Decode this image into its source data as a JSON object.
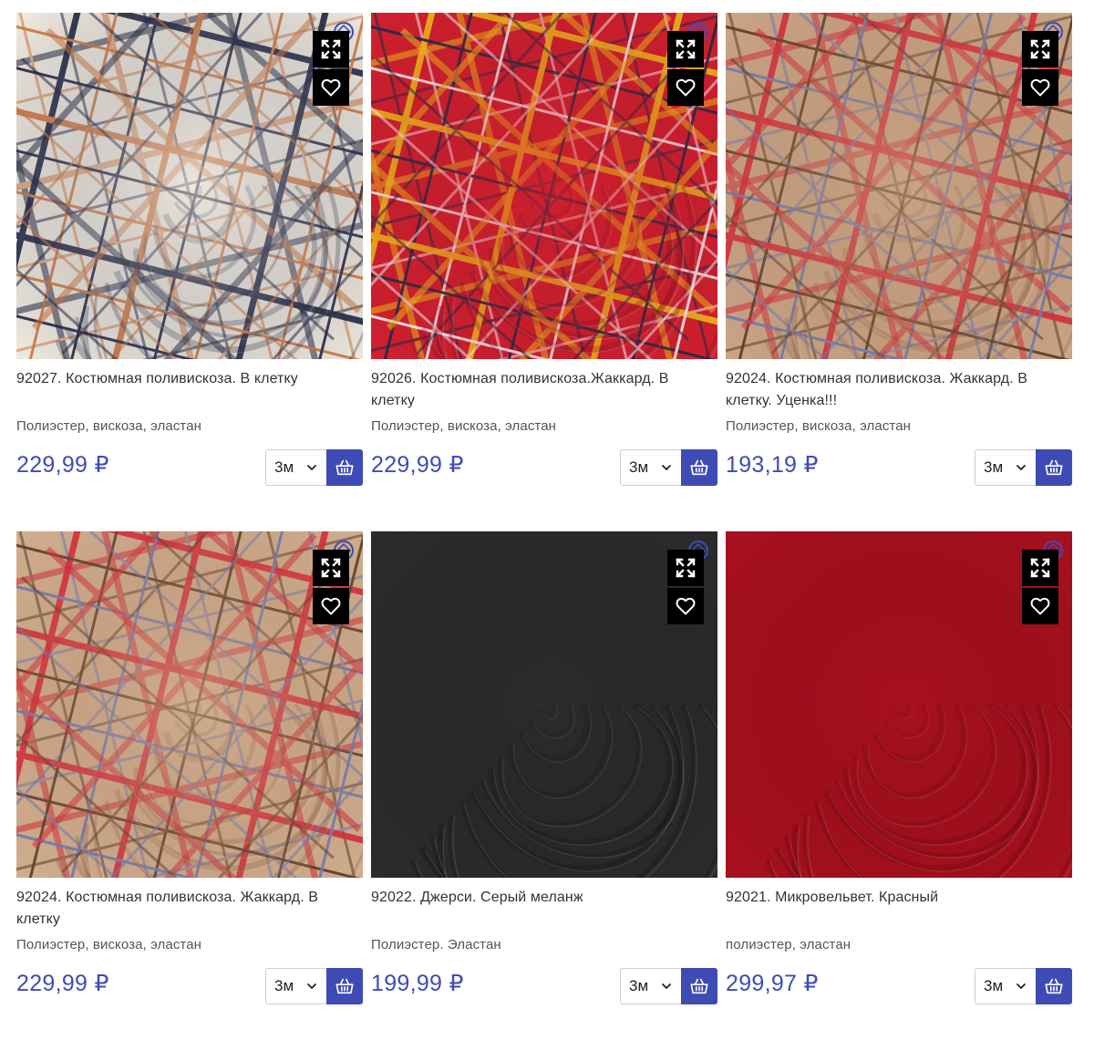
{
  "products": [
    {
      "title": "92027. Костюмная поливискоза. В клетку",
      "composition": "Полиэстер, вискоза, эластан",
      "price": "229,99 ₽",
      "qty": "3м",
      "fabric": {
        "base": "#eee8dd",
        "lines": [
          "#1f2440",
          "#d07840"
        ],
        "accent": "#1f2440"
      }
    },
    {
      "title": "92026. Костюмная поливискоза.Жаккард. В клетку",
      "composition": "Полиэстер, вискоза, эластан",
      "price": "229,99 ₽",
      "qty": "3м",
      "fabric": {
        "base": "#d0202e",
        "lines": [
          "#f2c21a",
          "#1c2a4a",
          "#ffffff"
        ],
        "accent": "#7a1020"
      }
    },
    {
      "title": "92024. Костюмная поливискоза. Жаккард. В клетку. Уценка!!!",
      "composition": "Полиэстер, вискоза, эластан",
      "price": "193,19 ₽",
      "qty": "3м",
      "fabric": {
        "base": "#c9a585",
        "lines": [
          "#d8283a",
          "#5a3a2a",
          "#6a7ab8"
        ],
        "accent": "#8a5a40"
      }
    },
    {
      "title": "92024. Костюмная поливискоза. Жаккард. В клетку",
      "composition": "Полиэстер, вискоза, эластан",
      "price": "229,99 ₽",
      "qty": "3м",
      "fabric": {
        "base": "#cfae8e",
        "lines": [
          "#d8283a",
          "#5a3a2a",
          "#6a7ab8"
        ],
        "accent": "#8a5a40"
      }
    },
    {
      "title": "92022. Джерси. Серый меланж",
      "composition": "Полиэстер. Эластан",
      "price": "199,99 ₽",
      "qty": "3м",
      "fabric": {
        "base": "#2c2b2d",
        "lines": [],
        "accent": "#111012"
      }
    },
    {
      "title": "92021. Микровельвет. Красный",
      "composition": "полиэстер, эластан",
      "price": "299,97 ₽",
      "qty": "3м",
      "fabric": {
        "base": "#a8101e",
        "lines": [],
        "accent": "#5e0610"
      }
    }
  ],
  "icons": {
    "expand": "expand-icon",
    "favorite": "heart-icon",
    "dropdown": "chevron-down-icon",
    "cart": "basket-icon"
  },
  "colors": {
    "accent": "#3f4bb5",
    "overlay_button": "#000000"
  }
}
